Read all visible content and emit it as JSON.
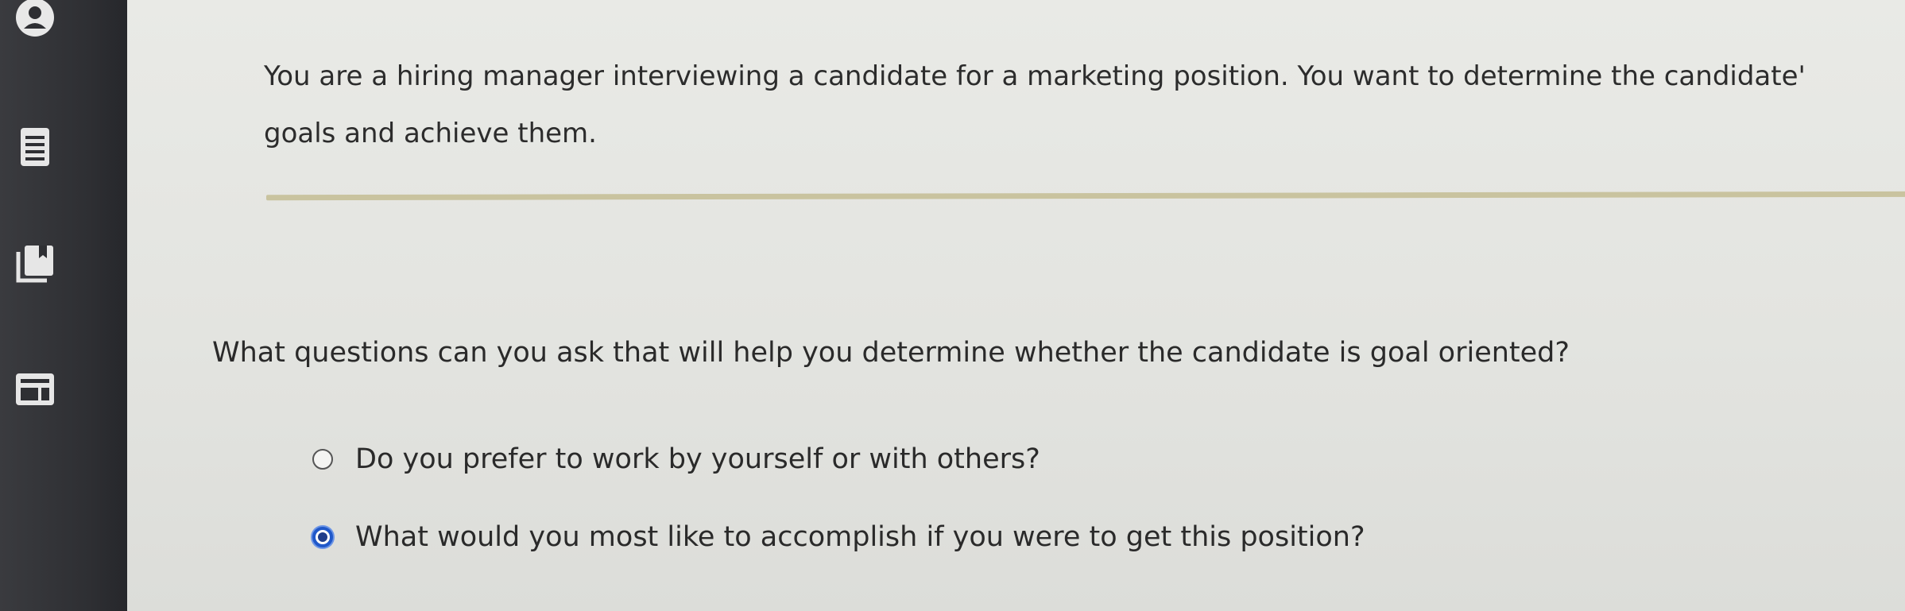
{
  "sidebar": {
    "items": [
      {
        "icon": "account-icon"
      },
      {
        "icon": "document-list-icon"
      },
      {
        "icon": "bookmark-book-icon"
      },
      {
        "icon": "layout-panel-icon"
      }
    ]
  },
  "scenario": {
    "line1": "You are a hiring manager interviewing a candidate for a marketing position. You want to determine the candidate'",
    "line2": "goals and achieve them."
  },
  "question": {
    "text": "What questions can you ask that will help you determine whether the candidate is goal oriented?"
  },
  "options": [
    {
      "label": "Do you prefer to work by yourself or with others?",
      "selected": false
    },
    {
      "label": "What would you most like to accomplish if you were to get this position?",
      "selected": true
    }
  ],
  "colors": {
    "accent": "#2058c9",
    "sidebar": "#2e2f33",
    "divider": "#c9c39f"
  }
}
